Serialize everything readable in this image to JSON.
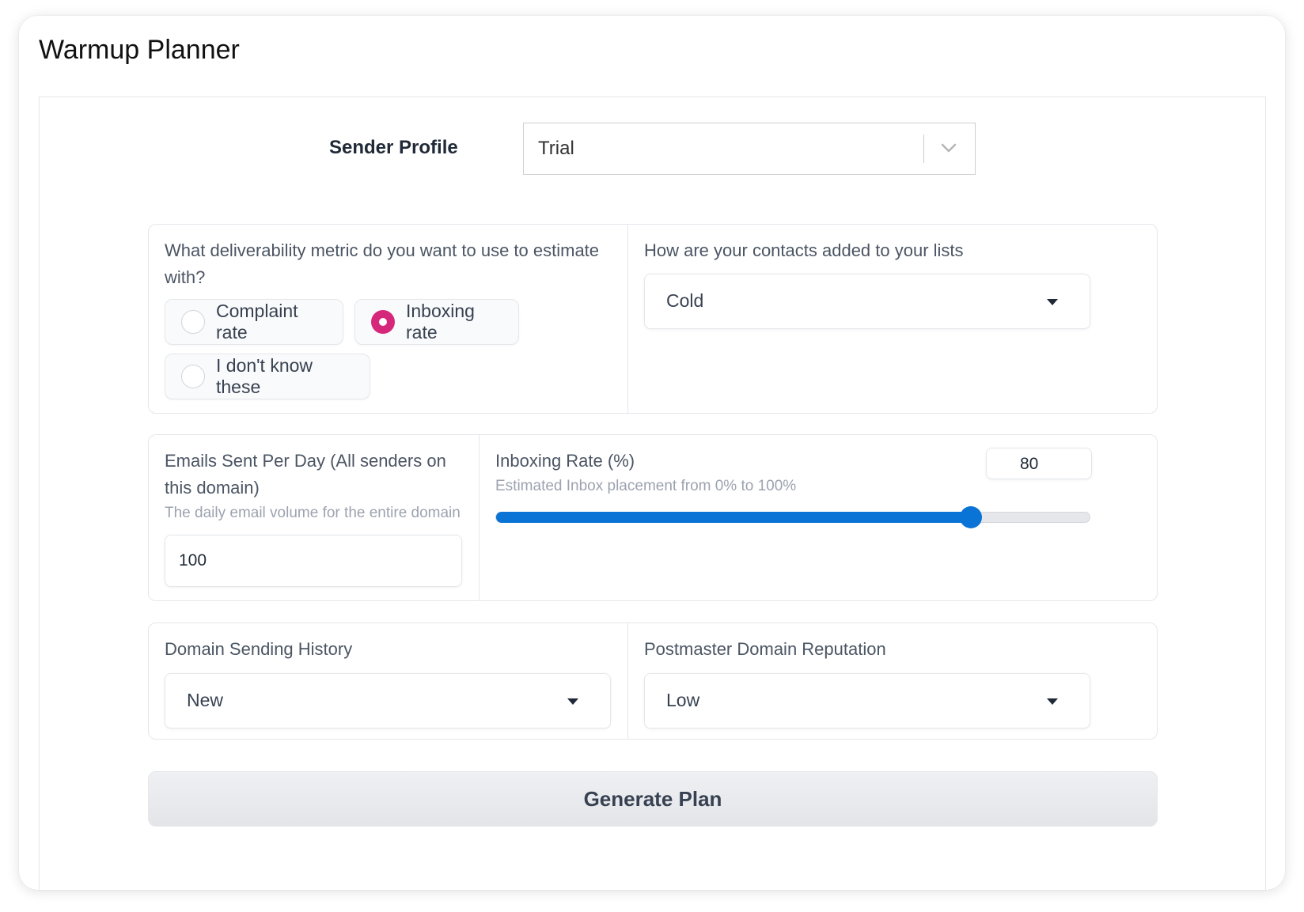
{
  "app": {
    "title": "Warmup Planner"
  },
  "sender_profile": {
    "label": "Sender Profile",
    "value": "Trial"
  },
  "metric": {
    "question": "What deliverability metric do you want to use to estimate with?",
    "options": [
      {
        "label": "Complaint rate",
        "checked": false
      },
      {
        "label": "Inboxing rate",
        "checked": true
      },
      {
        "label": "I don't know these",
        "checked": false
      }
    ]
  },
  "contacts": {
    "question": "How are your contacts added to your lists",
    "value": "Cold"
  },
  "emails_per_day": {
    "label": "Emails Sent Per Day (All senders on this domain)",
    "help": "The daily email volume for the entire domain",
    "value": "100"
  },
  "inboxing_rate": {
    "label": "Inboxing Rate (%)",
    "help": "Estimated Inbox placement from 0% to 100%",
    "value": "80",
    "level": 80,
    "min": 0,
    "max": 100
  },
  "domain_history": {
    "label": "Domain Sending History",
    "value": "New"
  },
  "postmaster": {
    "label": "Postmaster Domain Reputation",
    "value": "Low"
  },
  "actions": {
    "generate_label": "Generate Plan"
  },
  "colors": {
    "accent": "#d6287a",
    "slider": "#0a73d6"
  },
  "icons": {
    "select_chevron": "chevron-down-icon",
    "dropdown_caret": "caret-down-icon"
  }
}
